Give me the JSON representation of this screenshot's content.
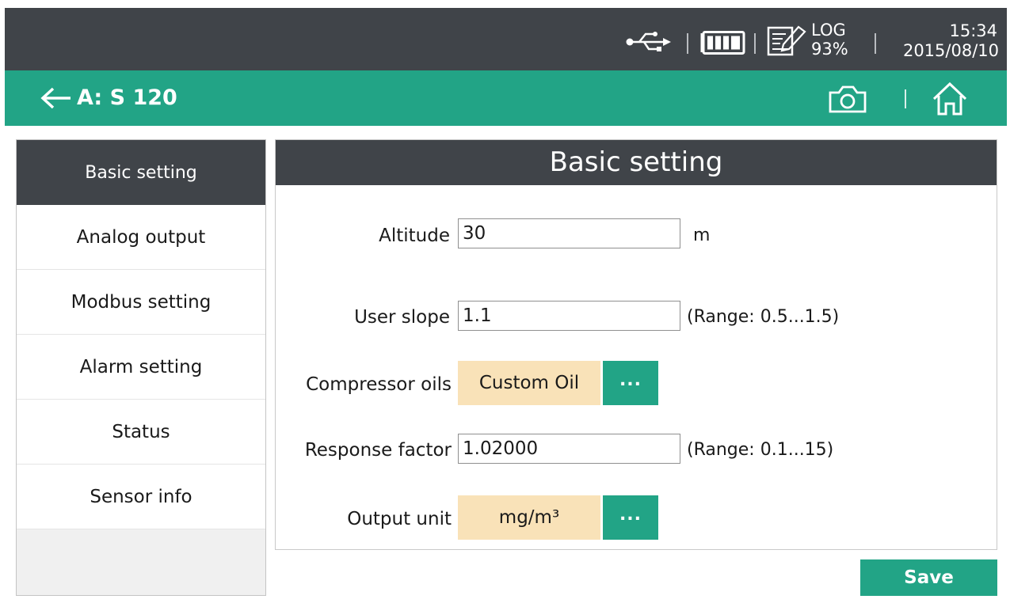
{
  "status_bar": {
    "usb_icon": "usb-icon",
    "battery_icon": "battery-icon",
    "log_icon": "log-edit-icon",
    "log_label": "LOG",
    "log_percent": "93%",
    "time": "15:34",
    "date": "2015/08/10"
  },
  "title_bar": {
    "back_icon": "arrow-left-icon",
    "device_name": "A: S 120",
    "camera_icon": "camera-icon",
    "home_icon": "home-icon"
  },
  "sidebar": {
    "items": [
      {
        "label": "Basic setting",
        "active": true
      },
      {
        "label": "Analog output",
        "active": false
      },
      {
        "label": "Modbus setting",
        "active": false
      },
      {
        "label": "Alarm setting",
        "active": false
      },
      {
        "label": "Status",
        "active": false
      },
      {
        "label": "Sensor info",
        "active": false
      }
    ]
  },
  "panel": {
    "title": "Basic setting",
    "altitude": {
      "label": "Altitude",
      "value": "30",
      "unit": "m"
    },
    "user_slope": {
      "label": "User slope",
      "value": "1.1",
      "range": "(Range: 0.5...1.5)"
    },
    "compressor_oils": {
      "label": "Compressor oils",
      "value": "Custom Oil",
      "more": "..."
    },
    "response_factor": {
      "label": "Response factor",
      "value": "1.02000",
      "range": "(Range: 0.1...15)"
    },
    "output_unit": {
      "label": "Output unit",
      "value": "mg/m³",
      "more": "..."
    }
  },
  "save_label": "Save",
  "colors": {
    "accent": "#22a486",
    "dark_header": "#404449",
    "option_fill": "#f9e2b8"
  }
}
